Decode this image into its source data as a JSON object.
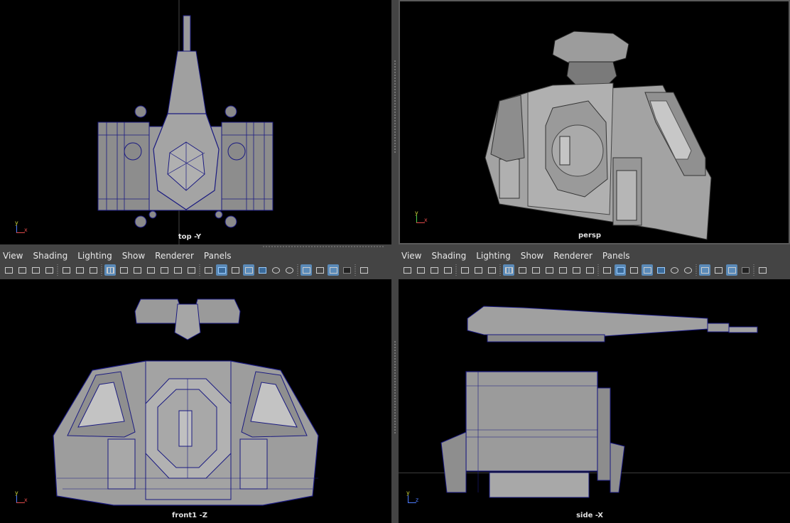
{
  "viewports": {
    "top": {
      "label": "top -Y"
    },
    "persp": {
      "label": "persp"
    },
    "front": {
      "label": "front1 -Z"
    },
    "side": {
      "label": "side -X"
    }
  },
  "axes": {
    "top": {
      "up": "y",
      "right": "x"
    },
    "persp": {
      "up": "y",
      "right": "x"
    },
    "front": {
      "up": "y",
      "right": "x"
    },
    "side": {
      "up": "y",
      "right": "z"
    }
  },
  "panel_menu": [
    "View",
    "Shading",
    "Lighting",
    "Show",
    "Renderer",
    "Panels"
  ],
  "toolbar_icons": [
    "camera-icon",
    "camera-lock-icon",
    "camera-attr-icon",
    "bookmark-icon",
    "sep",
    "image-plane-icon",
    "2d-pan-icon",
    "grease-pencil-icon",
    "sep",
    "grid-icon",
    "film-gate-icon",
    "resolution-gate-icon",
    "gate-mask-icon",
    "field-chart-icon",
    "safe-action-icon",
    "safe-title-icon",
    "sep",
    "wireframe-icon",
    "smooth-shade-icon",
    "default-material-icon",
    "wireframe-on-shaded-icon",
    "textured-icon",
    "use-lights-icon",
    "shadows-icon",
    "sep",
    "screen-space-ao-icon",
    "motion-blur-icon",
    "anti-alias-icon",
    "depth-of-field-icon",
    "sep",
    "isolate-select-icon"
  ],
  "colors": {
    "wire": "#1e1e8c",
    "surface": "#8a8a8a",
    "active_tool": "#5a8ab8"
  }
}
